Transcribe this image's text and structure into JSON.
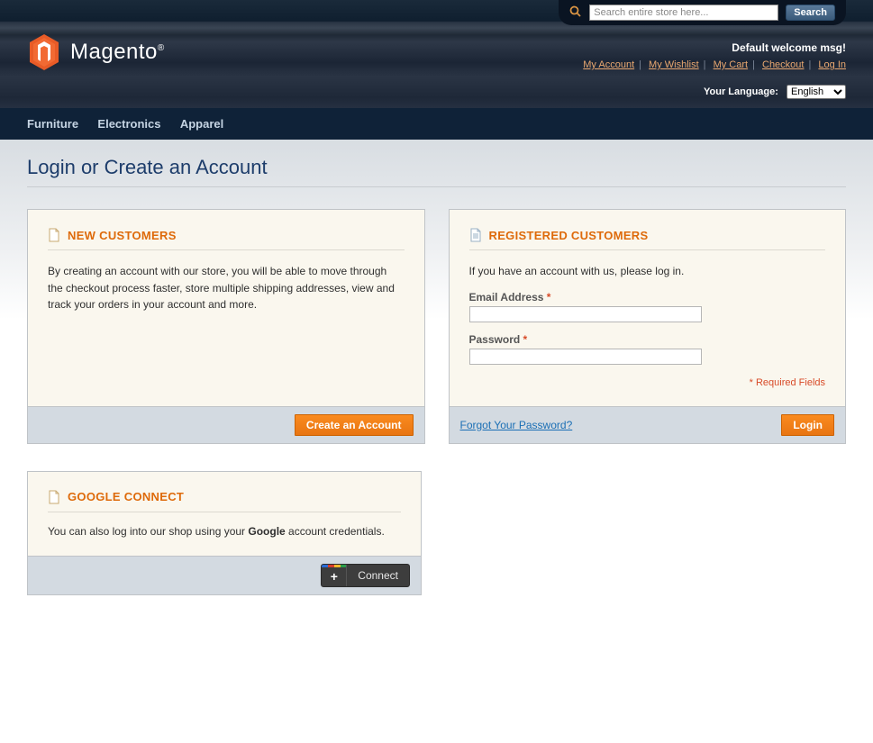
{
  "header": {
    "search_placeholder": "Search entire store here...",
    "search_button": "Search",
    "logo_text": "Magento",
    "welcome": "Default welcome msg!",
    "links": [
      "My Account",
      "My Wishlist",
      "My Cart",
      "Checkout",
      "Log In"
    ],
    "language_label": "Your Language:",
    "language_selected": "English",
    "language_options": [
      "English"
    ]
  },
  "nav": [
    "Furniture",
    "Electronics",
    "Apparel"
  ],
  "page_title": "Login or Create an Account",
  "new_customers": {
    "title": "NEW CUSTOMERS",
    "text": "By creating an account with our store, you will be able to move through the checkout process faster, store multiple shipping addresses, view and track your orders in your account and more.",
    "button": "Create an Account"
  },
  "registered": {
    "title": "REGISTERED CUSTOMERS",
    "intro": "If you have an account with us, please log in.",
    "email_label": "Email Address",
    "password_label": "Password",
    "required_note": "* Required Fields",
    "forgot": "Forgot Your Password?",
    "login_button": "Login"
  },
  "google": {
    "title": "GOOGLE CONNECT",
    "text_before": "You can also log into our shop using your ",
    "text_bold": "Google",
    "text_after": " account credentials.",
    "button": "Connect"
  }
}
